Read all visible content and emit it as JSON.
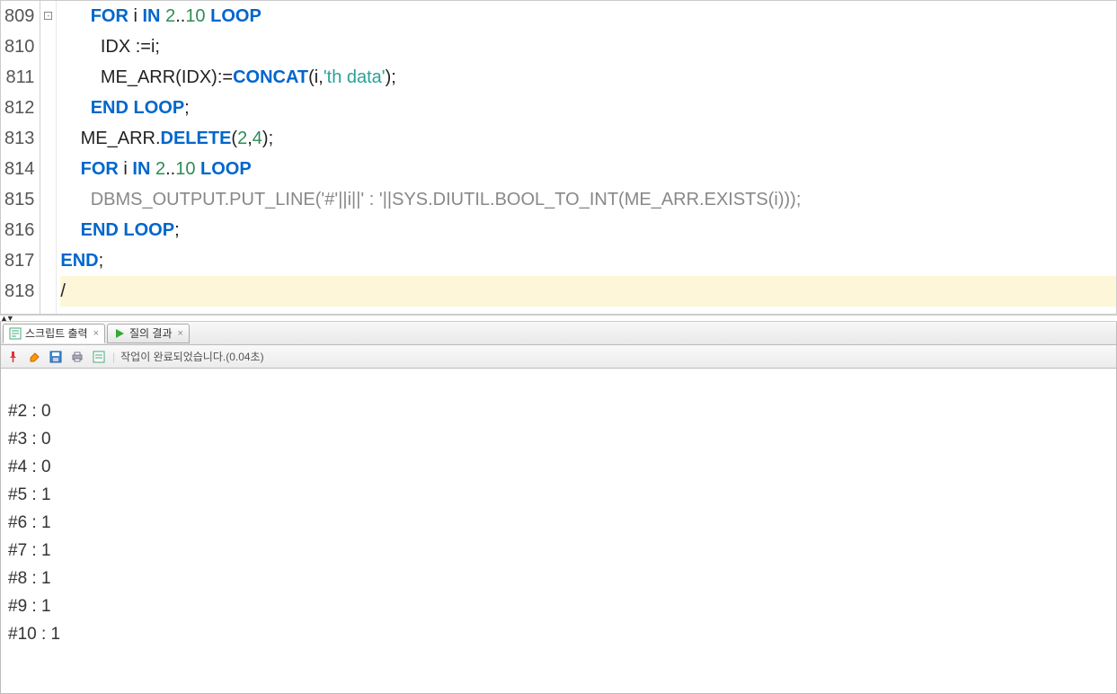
{
  "editor": {
    "lines": [
      {
        "num": "809",
        "fold": true,
        "tokens": [
          {
            "t": "plain",
            "v": "      "
          },
          {
            "t": "kw",
            "v": "FOR"
          },
          {
            "t": "plain",
            "v": " i "
          },
          {
            "t": "kw",
            "v": "IN"
          },
          {
            "t": "plain",
            "v": " "
          },
          {
            "t": "num",
            "v": "2"
          },
          {
            "t": "plain",
            "v": ".."
          },
          {
            "t": "num",
            "v": "10"
          },
          {
            "t": "plain",
            "v": " "
          },
          {
            "t": "kw",
            "v": "LOOP"
          }
        ]
      },
      {
        "num": "810",
        "fold": false,
        "tokens": [
          {
            "t": "plain",
            "v": "        IDX :=i;"
          }
        ]
      },
      {
        "num": "811",
        "fold": false,
        "tokens": [
          {
            "t": "plain",
            "v": "        ME_ARR(IDX):="
          },
          {
            "t": "func",
            "v": "CONCAT"
          },
          {
            "t": "plain",
            "v": "(i,"
          },
          {
            "t": "str",
            "v": "'th data'"
          },
          {
            "t": "plain",
            "v": ");"
          }
        ]
      },
      {
        "num": "812",
        "fold": false,
        "tokens": [
          {
            "t": "plain",
            "v": "      "
          },
          {
            "t": "kw",
            "v": "END LOOP"
          },
          {
            "t": "plain",
            "v": ";"
          }
        ]
      },
      {
        "num": "813",
        "fold": false,
        "tokens": [
          {
            "t": "plain",
            "v": "    ME_ARR."
          },
          {
            "t": "func",
            "v": "DELETE"
          },
          {
            "t": "plain",
            "v": "("
          },
          {
            "t": "num",
            "v": "2"
          },
          {
            "t": "plain",
            "v": ","
          },
          {
            "t": "num",
            "v": "4"
          },
          {
            "t": "plain",
            "v": ");"
          }
        ]
      },
      {
        "num": "814",
        "fold": false,
        "tokens": [
          {
            "t": "plain",
            "v": "    "
          },
          {
            "t": "kw",
            "v": "FOR"
          },
          {
            "t": "plain",
            "v": " i "
          },
          {
            "t": "kw",
            "v": "IN"
          },
          {
            "t": "plain",
            "v": " "
          },
          {
            "t": "num",
            "v": "2"
          },
          {
            "t": "plain",
            "v": ".."
          },
          {
            "t": "num",
            "v": "10"
          },
          {
            "t": "plain",
            "v": " "
          },
          {
            "t": "kw",
            "v": "LOOP"
          }
        ]
      },
      {
        "num": "815",
        "fold": false,
        "tokens": [
          {
            "t": "plain",
            "v": "      "
          },
          {
            "t": "call",
            "v": "DBMS_OUTPUT.PUT_LINE('#'||i||' : '||SYS.DIUTIL.BOOL_TO_INT(ME_ARR.EXISTS(i)));"
          }
        ]
      },
      {
        "num": "816",
        "fold": false,
        "tokens": [
          {
            "t": "plain",
            "v": "    "
          },
          {
            "t": "kw",
            "v": "END LOOP"
          },
          {
            "t": "plain",
            "v": ";"
          }
        ]
      },
      {
        "num": "817",
        "fold": false,
        "tokens": [
          {
            "t": "kw",
            "v": "END"
          },
          {
            "t": "plain",
            "v": ";"
          }
        ]
      },
      {
        "num": "818",
        "fold": false,
        "highlight": true,
        "tokens": [
          {
            "t": "plain",
            "v": "/"
          }
        ]
      }
    ]
  },
  "tabs": {
    "script_output": {
      "label": "스크립트 출력",
      "active": true
    },
    "query_result": {
      "label": "질의 결과",
      "active": false
    }
  },
  "toolbar": {
    "status": "작업이 완료되었습니다.(0.04초)"
  },
  "output": {
    "rows": [
      "#2 : 0",
      "#3 : 0",
      "#4 : 0",
      "#5 : 1",
      "#6 : 1",
      "#7 : 1",
      "#8 : 1",
      "#9 : 1",
      "#10 : 1"
    ]
  }
}
